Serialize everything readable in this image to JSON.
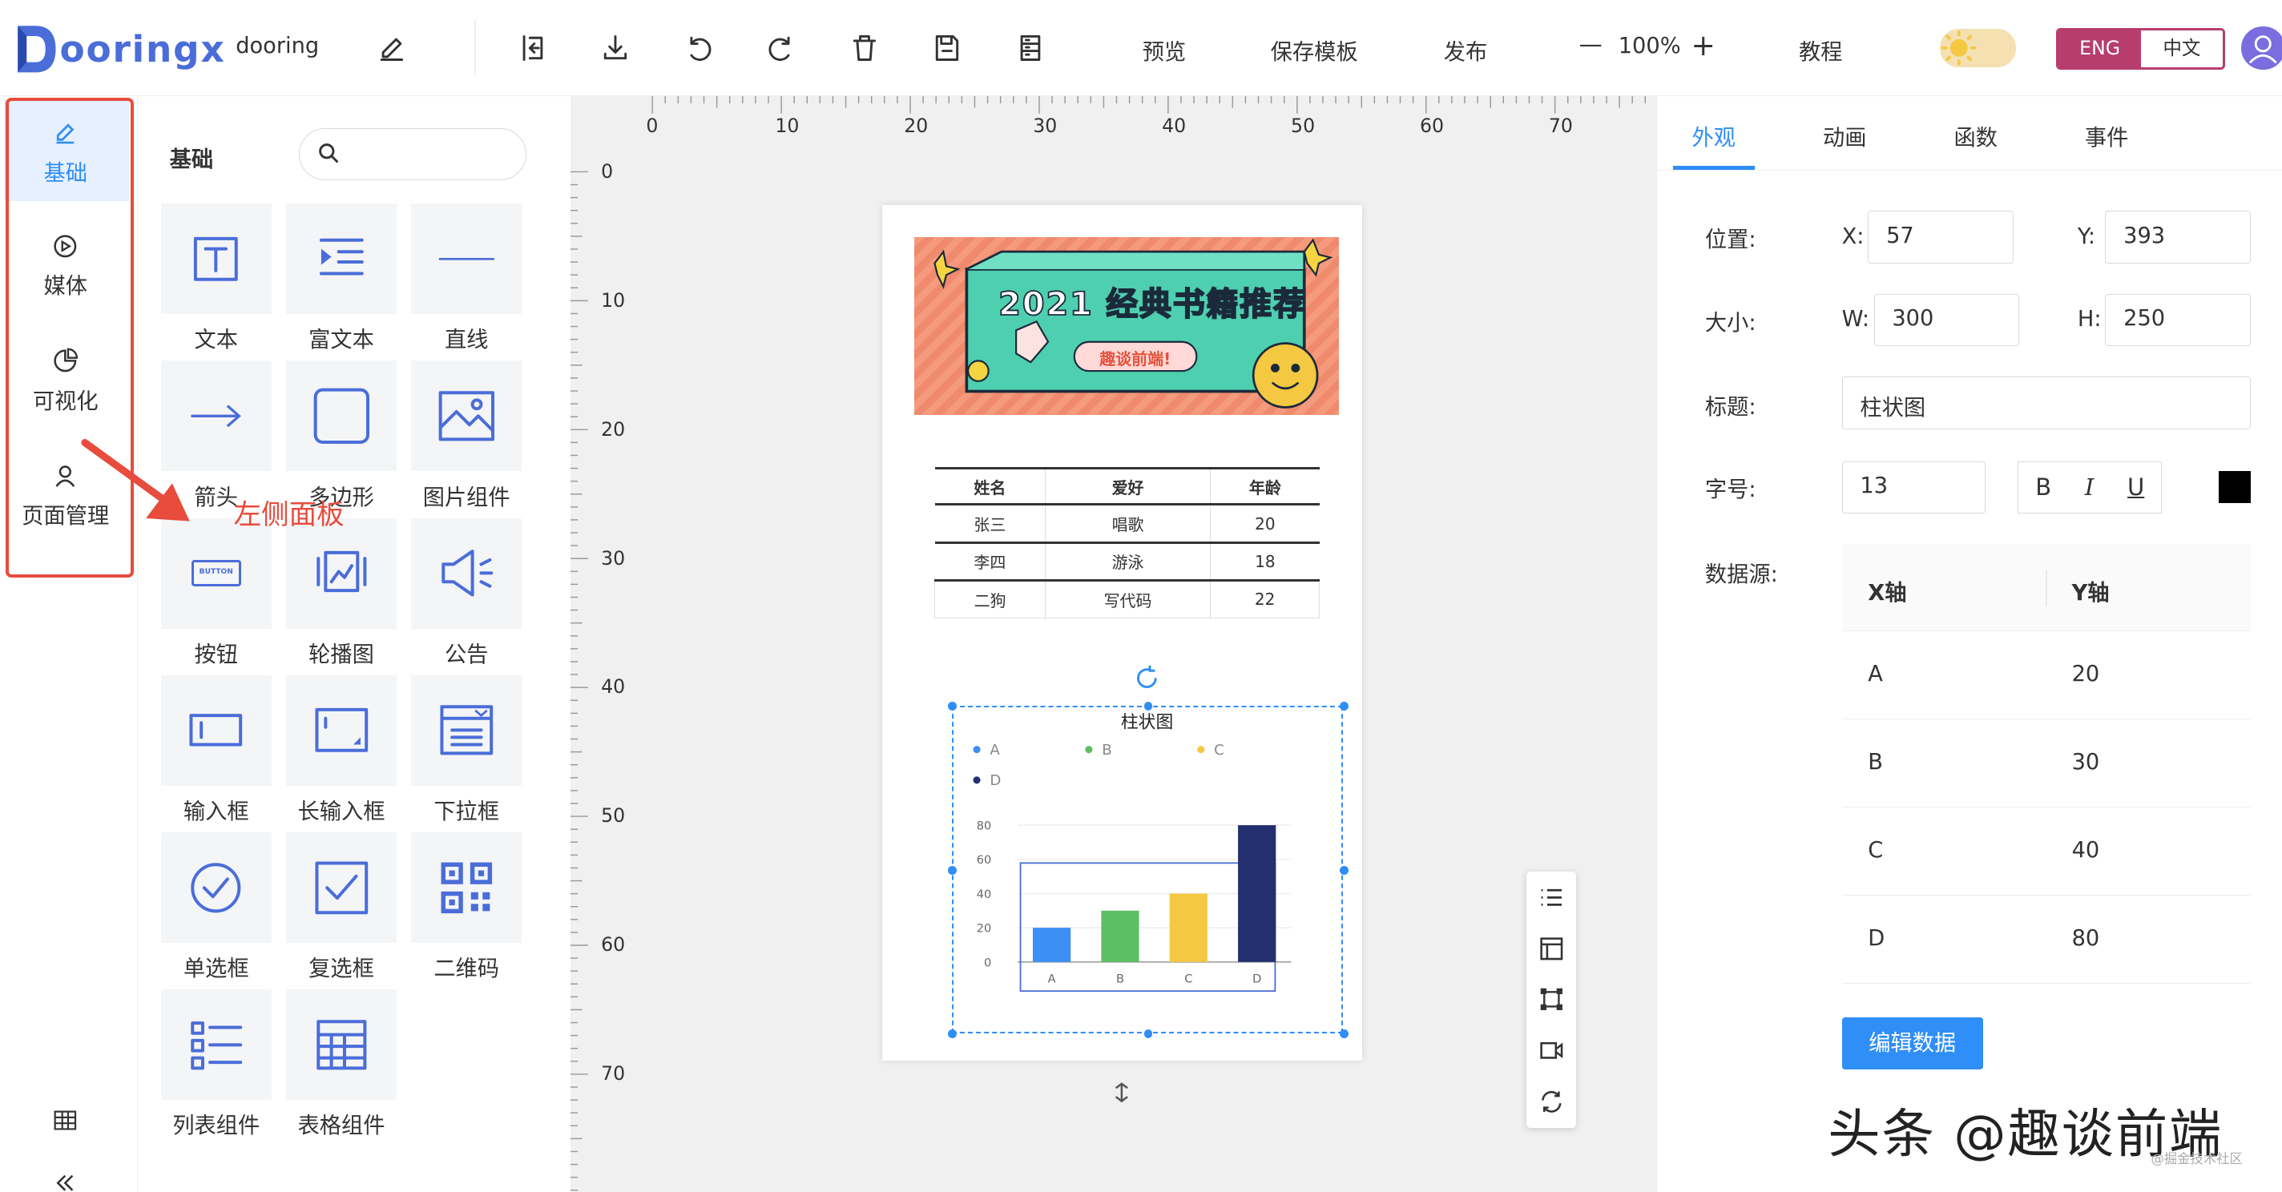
{
  "app": {
    "logo_text": "ooringx",
    "project_name": "dooring"
  },
  "toolbar": {
    "preview": "预览",
    "save_template": "保存模板",
    "publish": "发布",
    "zoom": "100%",
    "zoom_minus": "—",
    "zoom_plus": "+",
    "tutorial": "教程",
    "lang_en": "ENG",
    "lang_cn": "中文"
  },
  "leftnav": {
    "items": [
      {
        "label": "基础",
        "icon": "brush-icon"
      },
      {
        "label": "媒体",
        "icon": "play-circle-icon"
      },
      {
        "label": "可视化",
        "icon": "pie-chart-icon"
      },
      {
        "label": "页面管理",
        "icon": "user-icon"
      }
    ],
    "annotation": "左侧面板"
  },
  "panel": {
    "title": "基础",
    "search_placeholder": "",
    "components": [
      {
        "label": "文本",
        "icon": "text-icon"
      },
      {
        "label": "富文本",
        "icon": "rich-text-icon"
      },
      {
        "label": "直线",
        "icon": "line-icon"
      },
      {
        "label": "箭头",
        "icon": "arrow-icon"
      },
      {
        "label": "多边形",
        "icon": "polygon-icon"
      },
      {
        "label": "图片组件",
        "icon": "image-icon"
      },
      {
        "label": "按钮",
        "icon": "button-icon"
      },
      {
        "label": "轮播图",
        "icon": "carousel-icon"
      },
      {
        "label": "公告",
        "icon": "megaphone-icon"
      },
      {
        "label": "输入框",
        "icon": "input-icon"
      },
      {
        "label": "长输入框",
        "icon": "textarea-icon"
      },
      {
        "label": "下拉框",
        "icon": "dropdown-icon"
      },
      {
        "label": "单选框",
        "icon": "radio-icon"
      },
      {
        "label": "复选框",
        "icon": "checkbox-icon"
      },
      {
        "label": "二维码",
        "icon": "qrcode-icon"
      },
      {
        "label": "列表组件",
        "icon": "list-icon"
      },
      {
        "label": "表格组件",
        "icon": "table-icon"
      }
    ],
    "button_glyph_text": "BUTTON"
  },
  "ruler": {
    "h_labels": [
      "0",
      "10",
      "20",
      "30",
      "40",
      "50",
      "60",
      "70"
    ],
    "v_labels": [
      "0",
      "10",
      "20",
      "30",
      "40",
      "50",
      "60",
      "70"
    ]
  },
  "page": {
    "banner": {
      "title": "2021 经典书籍推荐",
      "tag": "趣谈前端!"
    },
    "table": {
      "headers": [
        "姓名",
        "爱好",
        "年龄"
      ],
      "rows": [
        [
          "张三",
          "唱歌",
          "20"
        ],
        [
          "李四",
          "游泳",
          "18"
        ],
        [
          "二狗",
          "写代码",
          "22"
        ]
      ]
    }
  },
  "chart_data": {
    "type": "bar",
    "title": "柱状图",
    "categories": [
      "A",
      "B",
      "C",
      "D"
    ],
    "values": [
      20,
      30,
      40,
      80
    ],
    "legend": [
      "A",
      "B",
      "C",
      "D"
    ],
    "colors": [
      "#3b8ff5",
      "#5cbf63",
      "#f5c842",
      "#232f6e"
    ],
    "yticks": [
      "0",
      "20",
      "40",
      "60",
      "80"
    ],
    "ylim": [
      0,
      80
    ],
    "legend_position": "top-left"
  },
  "right": {
    "tabs": [
      "外观",
      "动画",
      "函数",
      "事件"
    ],
    "position_label": "位置:",
    "x_label": "X:",
    "x_value": "57",
    "y_label": "Y:",
    "y_value": "393",
    "size_label": "大小:",
    "w_label": "W:",
    "w_value": "300",
    "h_label": "H:",
    "h_value": "250",
    "title_label": "标题:",
    "title_value": "柱状图",
    "font_label": "字号:",
    "font_value": "13",
    "bold": "B",
    "italic": "I",
    "underline": "U",
    "datasource_label": "数据源:",
    "ds_headers": [
      "X轴",
      "Y轴"
    ],
    "ds_rows": [
      [
        "A",
        "20"
      ],
      [
        "B",
        "30"
      ],
      [
        "C",
        "40"
      ],
      [
        "D",
        "80"
      ]
    ],
    "edit_button": "编辑数据"
  },
  "watermark": {
    "main": "头条 @趣谈前端",
    "small": "@掘金技术社区"
  },
  "colors": {
    "accent": "#2f8ef7",
    "brand": "#4a6dd8",
    "annotation": "#e74c3c",
    "lang_en_bg": "#b73d6e"
  }
}
